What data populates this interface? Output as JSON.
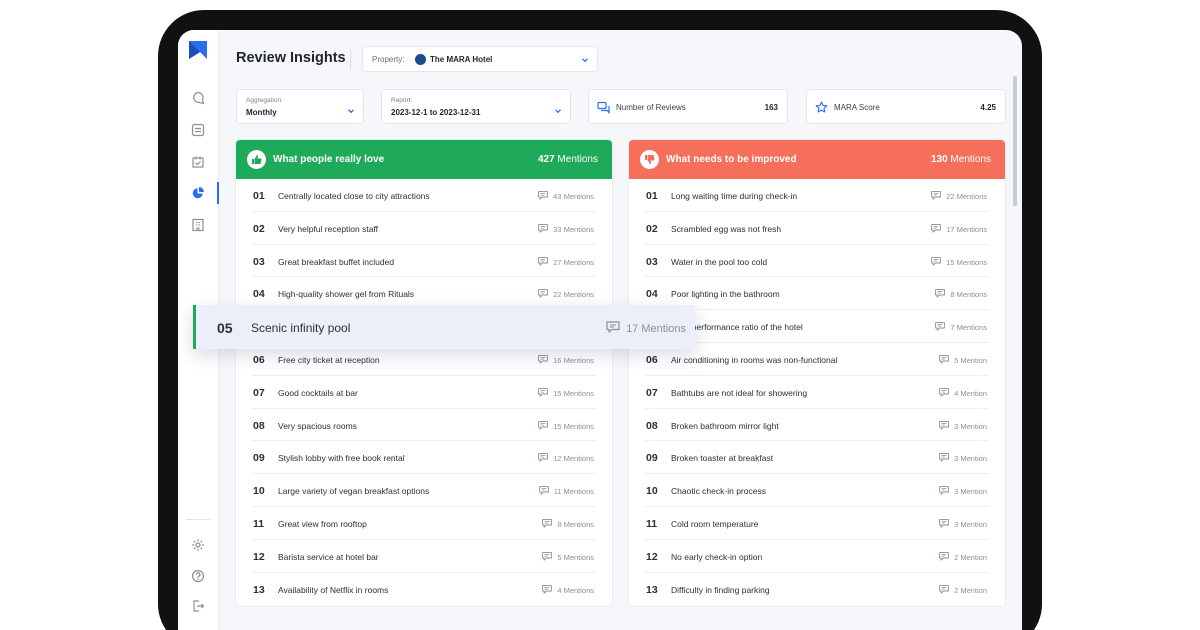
{
  "header": {
    "title": "Review Insights",
    "property_label": "Property:",
    "property_value": "The MARA Hotel"
  },
  "filters": {
    "aggregation_label": "Aggregation:",
    "aggregation_value": "Monthly",
    "report_label": "Report:",
    "report_value": "2023-12-1 to 2023-12-31"
  },
  "stats": {
    "reviews_label": "Number of Reviews",
    "reviews_value": "163",
    "score_label": "MARA Score",
    "score_value": "4.25"
  },
  "colors": {
    "positive": "#1faa59",
    "negative": "#f56f5a",
    "accent": "#2c6ef2"
  },
  "icons": {
    "nav": [
      "chat-icon",
      "list-icon",
      "tasks-icon",
      "pie-chart-icon",
      "building-icon"
    ],
    "bottom": [
      "settings-icon",
      "help-icon",
      "logout-icon"
    ]
  },
  "love": {
    "title": "What people really love",
    "count": "427",
    "count_suffix": "Mentions",
    "items": [
      {
        "rank": "01",
        "text": "Centrally located close to city attractions",
        "mentions": "43 Mentions"
      },
      {
        "rank": "02",
        "text": "Very helpful reception staff",
        "mentions": "33 Mentions"
      },
      {
        "rank": "03",
        "text": "Great breakfast buffet included",
        "mentions": "27 Mentions"
      },
      {
        "rank": "04",
        "text": "High-quality shower gel from Rituals",
        "mentions": "22 Mentions"
      },
      {
        "rank": "05",
        "text": "Scenic infinity pool",
        "mentions": "17 Mentions"
      },
      {
        "rank": "06",
        "text": "Free city ticket at reception",
        "mentions": "16 Mentions"
      },
      {
        "rank": "07",
        "text": "Good cocktails at bar",
        "mentions": "15 Mentions"
      },
      {
        "rank": "08",
        "text": "Very spacious rooms",
        "mentions": "15 Mentions"
      },
      {
        "rank": "09",
        "text": "Stylish lobby with free book rental",
        "mentions": "12 Mentions"
      },
      {
        "rank": "10",
        "text": "Large variety of vegan breakfast options",
        "mentions": "11 Mentions"
      },
      {
        "rank": "11",
        "text": "Great  view from rooftop",
        "mentions": "8 Mentions"
      },
      {
        "rank": "12",
        "text": "Barista service at hotel bar",
        "mentions": "5 Mentions"
      },
      {
        "rank": "13",
        "text": "Availability of Netflix in rooms",
        "mentions": "4 Mentions"
      }
    ]
  },
  "improve": {
    "title": "What needs to be improved",
    "count": "130",
    "count_suffix": "Mentions",
    "items": [
      {
        "rank": "01",
        "text": "Long waiting time during check-in",
        "mentions": "22 Mentions"
      },
      {
        "rank": "02",
        "text": "Scrambled egg was not fresh",
        "mentions": "17 Mentions"
      },
      {
        "rank": "03",
        "text": "Water in the pool too cold",
        "mentions": "15 Mentions"
      },
      {
        "rank": "04",
        "text": "Poor lighting in the bathroom",
        "mentions": "8 Mentions"
      },
      {
        "rank": "05",
        "text": "ce to performance ratio of the hotel",
        "mentions": "7 Mentions"
      },
      {
        "rank": "06",
        "text": "Air conditioning in rooms was non-functional",
        "mentions": "5 Mention"
      },
      {
        "rank": "07",
        "text": "Bathtubs are not ideal for showering",
        "mentions": "4 Mention"
      },
      {
        "rank": "08",
        "text": "Broken bathroom mirror light",
        "mentions": "3 Mention"
      },
      {
        "rank": "09",
        "text": "Broken toaster at breakfast",
        "mentions": "3 Mention"
      },
      {
        "rank": "10",
        "text": "Chaotic check-in process",
        "mentions": "3 Mention"
      },
      {
        "rank": "11",
        "text": "Cold room temperature",
        "mentions": "3 Mention"
      },
      {
        "rank": "12",
        "text": "No early check-in option",
        "mentions": "2 Mention"
      },
      {
        "rank": "13",
        "text": "Difficulty in finding parking",
        "mentions": "2 Mention"
      }
    ]
  },
  "highlight": {
    "rank": "05",
    "text": "Scenic infinity pool",
    "mentions": "17 Mentions"
  }
}
